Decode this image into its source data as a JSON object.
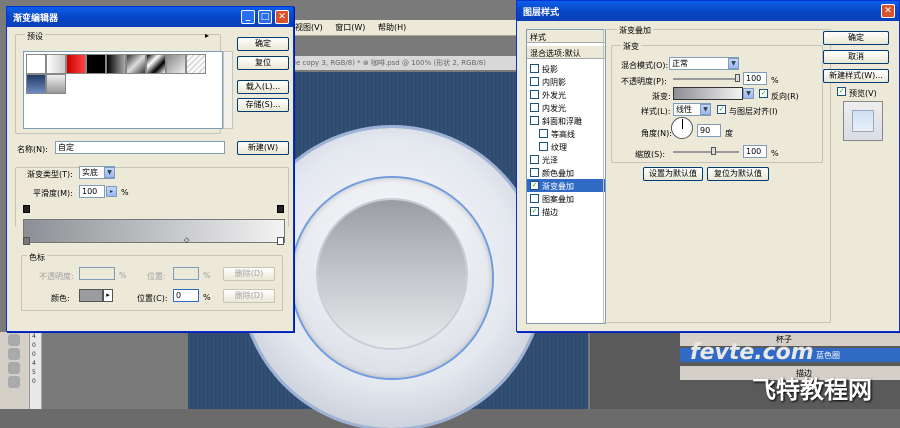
{
  "photoshop": {
    "menu": [
      "视图(V)",
      "窗口(W)",
      "帮助(H)"
    ],
    "doc_tab_fragment": "le copy 3, RGB/8) * ⊗    咖啡.psd @ 100% (形状 2, RGB/8)",
    "ruler_numbers": [
      "4",
      "0",
      "0",
      "4",
      "5",
      "0"
    ],
    "layers": {
      "cup_layer": "杯子",
      "blue_circle_layer": "蓝色圈",
      "effect_label": "描边"
    },
    "watermark_site": "fevte.com",
    "watermark_cn": "飞特教程网"
  },
  "gradient_editor": {
    "title": "渐变编辑器",
    "presets_label": "预设",
    "buttons": {
      "ok": "确定",
      "reset": "复位",
      "load": "载入(L)...",
      "save": "存储(S)...",
      "new": "新建(W)",
      "delete_opacity": "删除(D)",
      "delete_color": "删除(D)"
    },
    "name_label": "名称(N):",
    "name_value": "自定",
    "gradient_type_label": "渐变类型(T):",
    "gradient_type_value": "实底",
    "smoothness_label": "平滑度(M):",
    "smoothness_value": "100",
    "percent": "%",
    "stops_label": "色标",
    "opacity_label": "不透明度:",
    "location_label": "位置:",
    "color_label": "颜色:",
    "location_c_label": "位置(C):",
    "location_c_value": "0",
    "stop_color": "#9a9ca0",
    "gradient_start": "#8d8f94",
    "gradient_end": "#f3f3f3"
  },
  "layer_style": {
    "title": "图层样式",
    "styles_header": "样式",
    "blend_options": "混合选项:默认",
    "items": [
      {
        "label": "投影",
        "checked": false,
        "sub": false
      },
      {
        "label": "内阴影",
        "checked": false,
        "sub": false
      },
      {
        "label": "外发光",
        "checked": false,
        "sub": false
      },
      {
        "label": "内发光",
        "checked": false,
        "sub": false
      },
      {
        "label": "斜面和浮雕",
        "checked": false,
        "sub": false
      },
      {
        "label": "等高线",
        "checked": false,
        "sub": true
      },
      {
        "label": "纹理",
        "checked": false,
        "sub": true
      },
      {
        "label": "光泽",
        "checked": false,
        "sub": false
      },
      {
        "label": "颜色叠加",
        "checked": false,
        "sub": false
      },
      {
        "label": "渐变叠加",
        "checked": true,
        "sub": false,
        "selected": true
      },
      {
        "label": "图案叠加",
        "checked": false,
        "sub": false
      },
      {
        "label": "描边",
        "checked": true,
        "sub": false
      }
    ],
    "section_title": "渐变叠加",
    "gradient_group": "渐变",
    "blend_mode_label": "混合模式(O):",
    "blend_mode_value": "正常",
    "opacity_label": "不透明度(P):",
    "opacity_value": "100",
    "gradient_label": "渐变:",
    "reverse_label": "反向(R)",
    "style_label": "样式(L):",
    "style_value": "线性",
    "align_label": "与图层对齐(I)",
    "angle_label": "角度(N):",
    "angle_value": "90",
    "degree": "度",
    "scale_label": "缩放(S):",
    "scale_value": "100",
    "percent": "%",
    "set_default": "设置为默认值",
    "reset_default": "复位为默认值",
    "buttons": {
      "ok": "确定",
      "cancel": "取消",
      "new_style": "新建样式(W)...",
      "preview": "预览(V)"
    }
  }
}
